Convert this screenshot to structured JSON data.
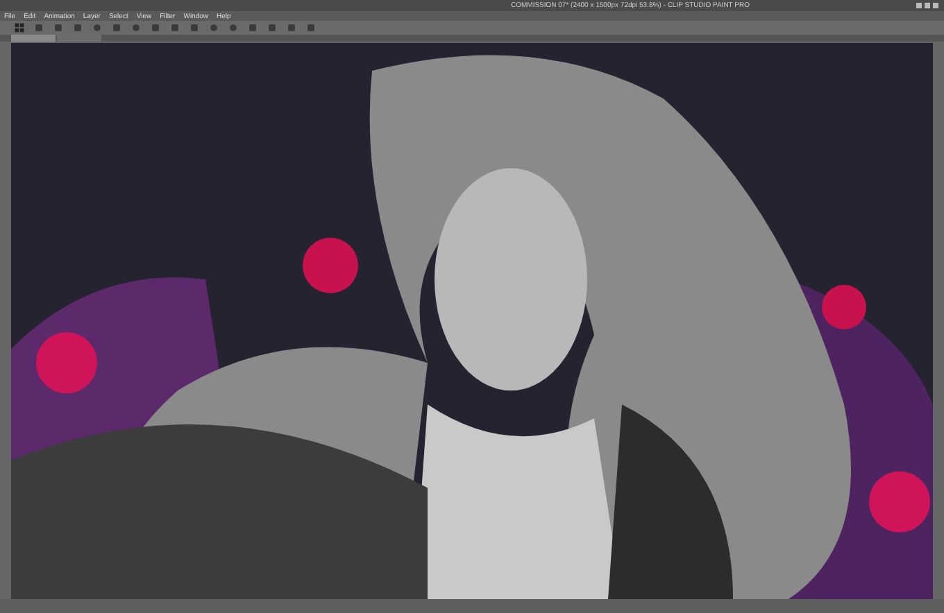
{
  "window": {
    "title": "COMMISSION 07* (2400 x 1500px 72dpi 53.8%) - CLIP STUDIO PAINT PRO"
  },
  "menu": [
    "File",
    "Edit",
    "Animation",
    "Layer",
    "Select",
    "View",
    "Filter",
    "Window",
    "Help"
  ],
  "toolbar": [
    {
      "kind": "grid"
    },
    {
      "kind": "square"
    },
    {
      "kind": "square"
    },
    {
      "kind": "square"
    },
    {
      "kind": "circle"
    },
    {
      "kind": "square"
    },
    {
      "kind": "circle"
    },
    {
      "kind": "square"
    },
    {
      "kind": "square"
    },
    {
      "kind": "square"
    },
    {
      "kind": "circle"
    },
    {
      "kind": "circle"
    },
    {
      "kind": "square"
    },
    {
      "kind": "square"
    },
    {
      "kind": "square"
    },
    {
      "kind": "square"
    }
  ],
  "tabs": [
    {
      "selected": true
    },
    {
      "selected": false
    }
  ]
}
